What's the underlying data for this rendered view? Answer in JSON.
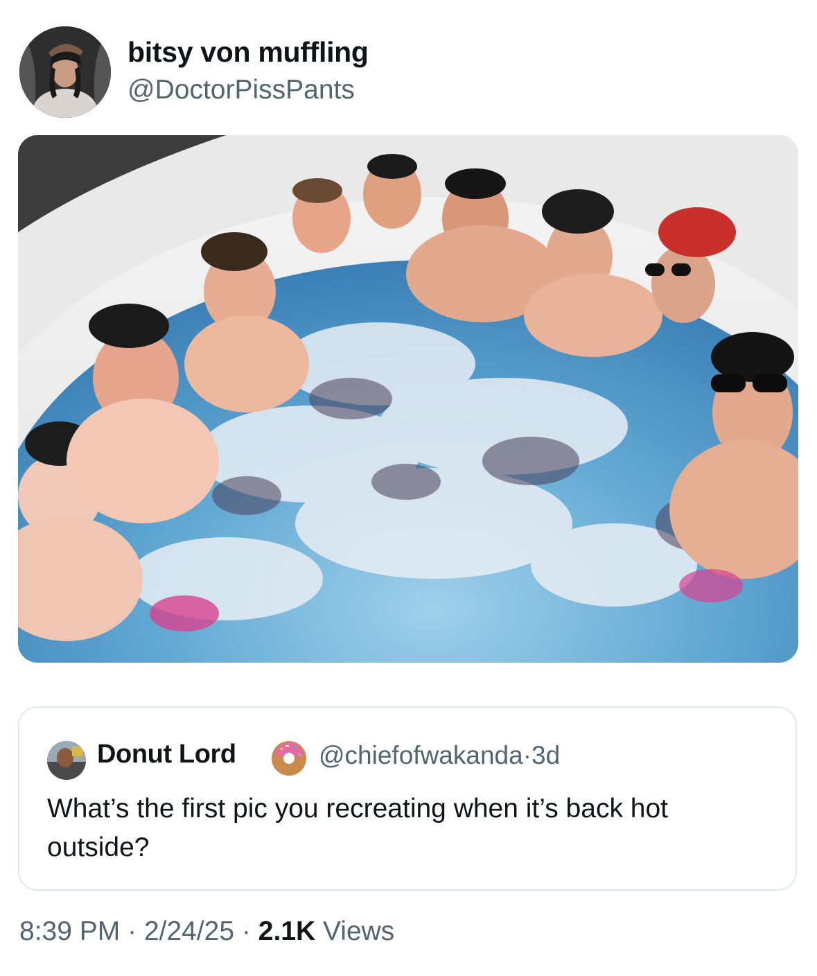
{
  "author": {
    "display_name": "bitsy von muffling",
    "handle": "@DoctorPissPants",
    "avatar_icon": "profile-photo"
  },
  "photo": {
    "icon": "hot-tub-group-photo"
  },
  "quote": {
    "display_name": "Donut Lord",
    "emoji_icon": "donut-emoji",
    "handle": "@chiefofwakanda",
    "separator": "·",
    "age": "3d",
    "text": "What’s the first pic you recreating when it’s back hot outside?"
  },
  "meta": {
    "time": "8:39 PM",
    "sep1": "·",
    "date": "2/24/25",
    "sep2": "·",
    "views_count": "2.1K",
    "views_label": "Views"
  },
  "colors": {
    "text_primary": "#0f1419",
    "text_secondary": "#536471",
    "border": "#e1e8ed"
  }
}
